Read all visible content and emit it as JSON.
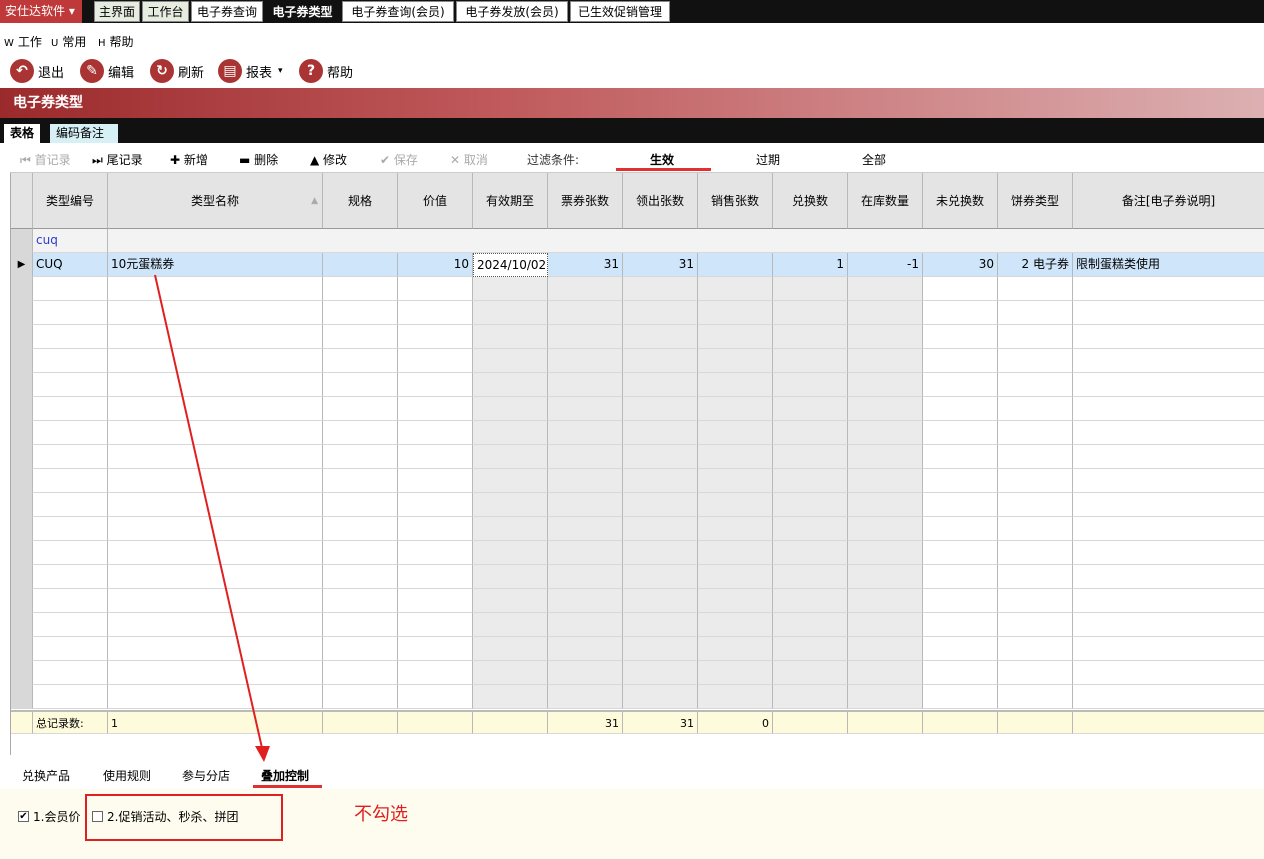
{
  "app": {
    "brand": "安仕达软件"
  },
  "tabs": [
    {
      "label": "主界面"
    },
    {
      "label": "工作台"
    },
    {
      "label": "电子券查询"
    },
    {
      "label": "电子券类型"
    },
    {
      "label": "电子券查询(会员)"
    },
    {
      "label": "电子券发放(会员)"
    },
    {
      "label": "已生效促销管理"
    }
  ],
  "menu": {
    "work": {
      "key": "W",
      "label": "工作"
    },
    "common": {
      "key": "U",
      "label": "常用"
    },
    "help": {
      "key": "H",
      "label": "帮助"
    }
  },
  "toolbar": {
    "exit": "退出",
    "edit": "编辑",
    "refresh": "刷新",
    "report": "报表",
    "help": "帮助"
  },
  "page_title": "电子券类型",
  "sheet_tabs": {
    "table": "表格",
    "code_note": "编码备注"
  },
  "nav": {
    "first": "首记录",
    "last": "尾记录",
    "add": "新增",
    "delete": "删除",
    "modify": "修改",
    "save": "保存",
    "cancel": "取消"
  },
  "filter": {
    "label": "过滤条件:",
    "options": [
      "生效",
      "过期",
      "全部"
    ],
    "selected": "生效"
  },
  "grid": {
    "columns": [
      "类型编号",
      "类型名称",
      "规格",
      "价值",
      "有效期至",
      "票券张数",
      "领出张数",
      "销售张数",
      "兑换数",
      "在库数量",
      "未兑换数",
      "饼券类型",
      "备注[电子券说明]"
    ],
    "filter_row": {
      "code": "cuq"
    },
    "rows": [
      {
        "code": "CUQ",
        "name": "10元蛋糕券",
        "spec": "",
        "value": "10",
        "expiry": "2024/10/02",
        "tickets": "31",
        "issued": "31",
        "sold": "",
        "redeemed": "1",
        "stock": "-1",
        "unredeemed": "30",
        "type": "2 电子券",
        "remark": "限制蛋糕类使用"
      }
    ],
    "footer": {
      "label": "总记录数:",
      "count": "1",
      "tickets": "31",
      "issued": "31",
      "sold": "0"
    }
  },
  "bottom_tabs": [
    "兑换产品",
    "使用规则",
    "参与分店",
    "叠加控制"
  ],
  "bottom_tab_selected": "叠加控制",
  "options": {
    "member_price": {
      "label": "1.会员价",
      "checked": true
    },
    "promotions": {
      "label": "2.促销活动、秒杀、拼团",
      "checked": false
    }
  },
  "annotation": {
    "note": "不勾选"
  },
  "colors": {
    "accent": "#e02020",
    "title_bar": "#9b2a2c",
    "brand": "#c0393a"
  }
}
